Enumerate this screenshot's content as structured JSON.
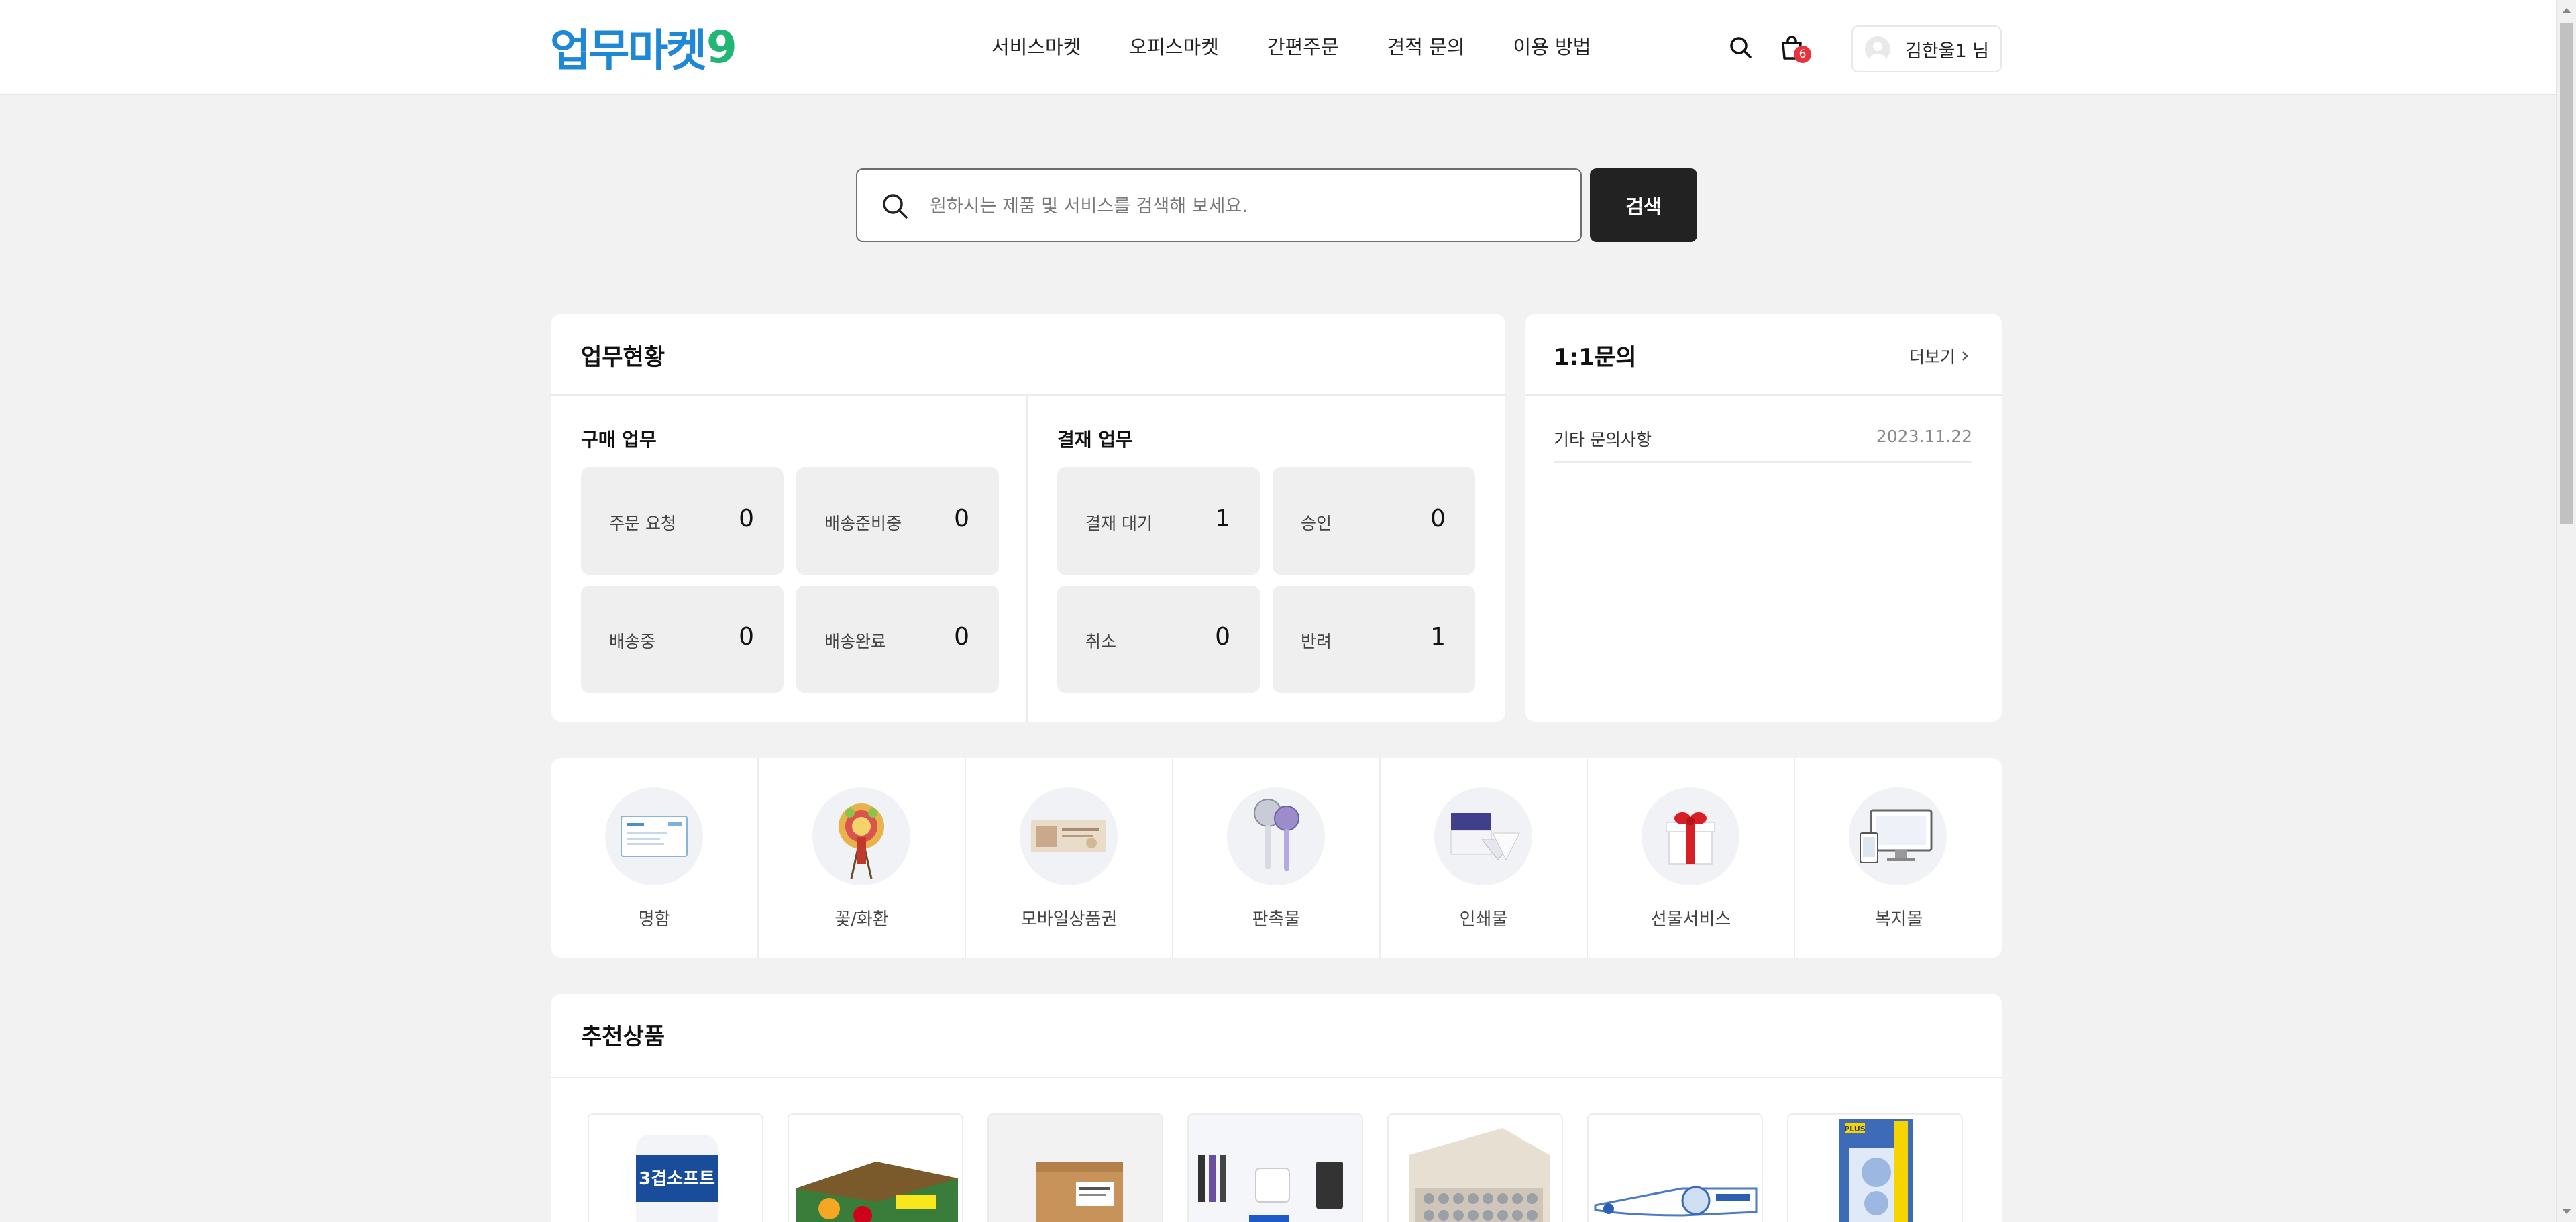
{
  "header": {
    "logo_main": "업무마켓",
    "logo_accent": "9",
    "nav": [
      "서비스마켓",
      "오피스마켓",
      "간편주문",
      "견적 문의",
      "이용 방법"
    ],
    "cart_count": "6",
    "user_name": "김한울1 님"
  },
  "search": {
    "placeholder": "원하시는 제품 및 서비스를 검색해 보세요.",
    "button_label": "검색"
  },
  "status": {
    "title": "업무현황",
    "purchase": {
      "title": "구매 업무",
      "items": [
        {
          "label": "주문 요청",
          "value": "0"
        },
        {
          "label": "배송준비중",
          "value": "0"
        },
        {
          "label": "배송중",
          "value": "0"
        },
        {
          "label": "배송완료",
          "value": "0"
        }
      ]
    },
    "approval": {
      "title": "결재 업무",
      "items": [
        {
          "label": "결재 대기",
          "value": "1"
        },
        {
          "label": "승인",
          "value": "0"
        },
        {
          "label": "취소",
          "value": "0"
        },
        {
          "label": "반려",
          "value": "1"
        }
      ]
    }
  },
  "inquiry": {
    "title": "1:1문의",
    "more_label": "더보기",
    "items": [
      {
        "title": "기타 문의사항",
        "date": "2023.11.22"
      }
    ]
  },
  "categories": [
    {
      "label": "명함",
      "icon": "business-card-icon"
    },
    {
      "label": "꽃/화환",
      "icon": "flower-wreath-icon"
    },
    {
      "label": "모바일상품권",
      "icon": "gift-voucher-icon"
    },
    {
      "label": "판촉물",
      "icon": "promo-fan-icon"
    },
    {
      "label": "인쇄물",
      "icon": "printed-matter-icon"
    },
    {
      "label": "선물서비스",
      "icon": "gift-box-icon"
    },
    {
      "label": "복지몰",
      "icon": "welfare-mall-icon"
    }
  ],
  "recommended": {
    "title": "추천상품",
    "products": [
      {
        "name": "3겹소프트",
        "icon": "toilet-paper-image"
      },
      {
        "name": "",
        "icon": "snack-box-image"
      },
      {
        "name": "",
        "icon": "cardboard-box-image"
      },
      {
        "name": "",
        "icon": "office-set-image"
      },
      {
        "name": "",
        "icon": "battery-pack-image"
      },
      {
        "name": "",
        "icon": "correction-tape-image"
      },
      {
        "name": "PLUS",
        "icon": "tape-refill-image"
      }
    ]
  },
  "colors": {
    "logo_blue": "#1e88d6",
    "logo_green": "#22b573",
    "badge_red": "#e8323c",
    "button_dark": "#222222"
  }
}
